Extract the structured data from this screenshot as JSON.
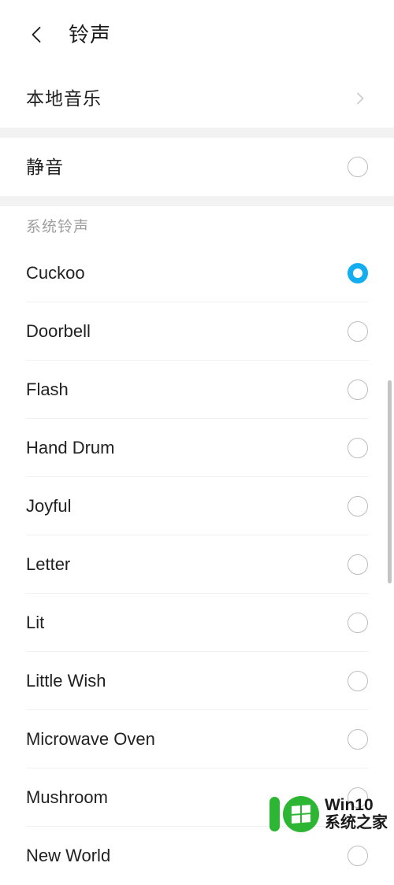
{
  "header": {
    "back_icon": "arrow-left-icon",
    "title": "铃声"
  },
  "local_music": {
    "label": "本地音乐",
    "chevron_icon": "chevron-right-icon"
  },
  "silent": {
    "label": "静音",
    "selected": false
  },
  "section": {
    "caption": "系统铃声"
  },
  "ringtones": [
    {
      "label": "Cuckoo",
      "selected": true
    },
    {
      "label": "Doorbell",
      "selected": false
    },
    {
      "label": "Flash",
      "selected": false
    },
    {
      "label": "Hand Drum",
      "selected": false
    },
    {
      "label": "Joyful",
      "selected": false
    },
    {
      "label": "Letter",
      "selected": false
    },
    {
      "label": "Lit",
      "selected": false
    },
    {
      "label": "Little Wish",
      "selected": false
    },
    {
      "label": "Microwave Oven",
      "selected": false
    },
    {
      "label": "Mushroom",
      "selected": false
    },
    {
      "label": "New World",
      "selected": false
    }
  ],
  "scrollbar": {
    "name": "vertical-scrollbar"
  },
  "watermark": {
    "line1": "Win10",
    "line2": "系统之家",
    "brand_color": "#2db633"
  },
  "colors": {
    "accent": "#14aef0",
    "text_primary": "#212121",
    "text_secondary": "#9e9e9e",
    "divider": "#f0f0f0",
    "band": "#f2f2f2",
    "background": "#ffffff"
  }
}
